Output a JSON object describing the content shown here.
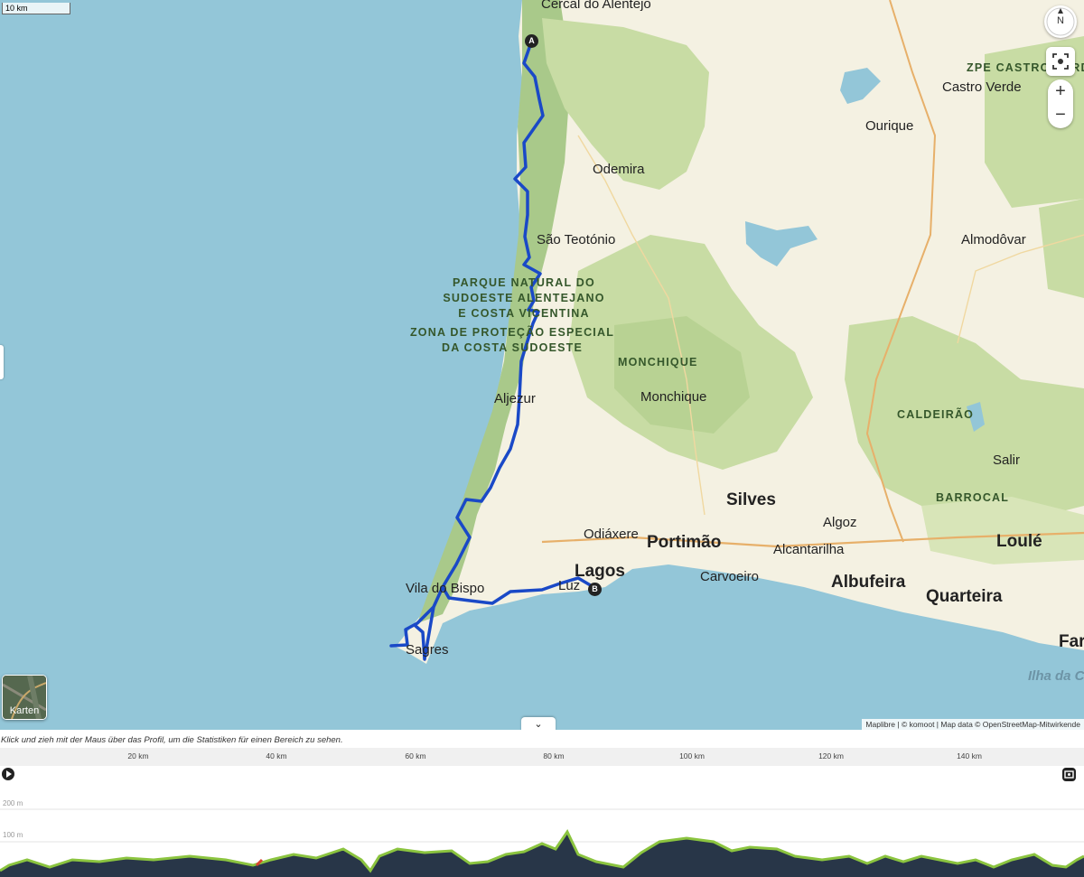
{
  "map": {
    "scale_label": "10 km",
    "attribution": "Maplibre | © komoot | Map data © OpenStreetMap-Mitwirkende",
    "layers_button_label": "Karten",
    "compass_label": "N",
    "zoom_in_label": "+",
    "zoom_out_label": "−",
    "collapse_label": "⌄",
    "start_marker": "A",
    "end_marker": "B",
    "colors": {
      "water": "#93c6d8",
      "land": "#f4f1e2",
      "forest": "#c8dca4",
      "park": "#a9c98a",
      "route": "#1a49c7"
    },
    "labels": {
      "cercal": "Cercal do Alentejo",
      "zpe_castro": "ZPE CASTRO VERDE",
      "castro_verde": "Castro Verde",
      "ourique": "Ourique",
      "odemira": "Odemira",
      "sao_teotonio": "São Teotónio",
      "almodovar": "Almodôvar",
      "parque": [
        "PARQUE NATURAL DO",
        "SUDOESTE ALENTEJANO",
        "E COSTA VICENTINA"
      ],
      "zona": [
        "ZONA DE PROTEÇÃO ESPECIAL",
        "DA COSTA SUDOESTE"
      ],
      "monchique_area": "MONCHIQUE",
      "monchique": "Monchique",
      "aljezur": "Aljezur",
      "caldeirao": "CALDEIRÃO",
      "salir": "Salir",
      "silves": "Silves",
      "barrocal": "BARROCAL",
      "odiaxere": "Odiáxere",
      "algoz": "Algoz",
      "portimao": "Portimão",
      "alcantarilha": "Alcantarilha",
      "loule": "Loulé",
      "lagos": "Lagos",
      "carvoeiro": "Carvoeiro",
      "albufeira": "Albufeira",
      "quarteira": "Quarteira",
      "vila_do_bispo": "Vila do Bispo",
      "luz": "Luz",
      "sagres": "Sagres",
      "faro": "Faro",
      "ilha": "Ilha da Culatra"
    }
  },
  "profile": {
    "hint": "Klick und zieh mit der Maus über das Profil, um die Statistiken für einen Bereich zu sehen.",
    "distance_ticks": [
      "20 km",
      "40 km",
      "60 km",
      "80 km",
      "100 km",
      "120 km",
      "140 km"
    ],
    "elevation_ticks": [
      "200 m",
      "100 m"
    ]
  }
}
